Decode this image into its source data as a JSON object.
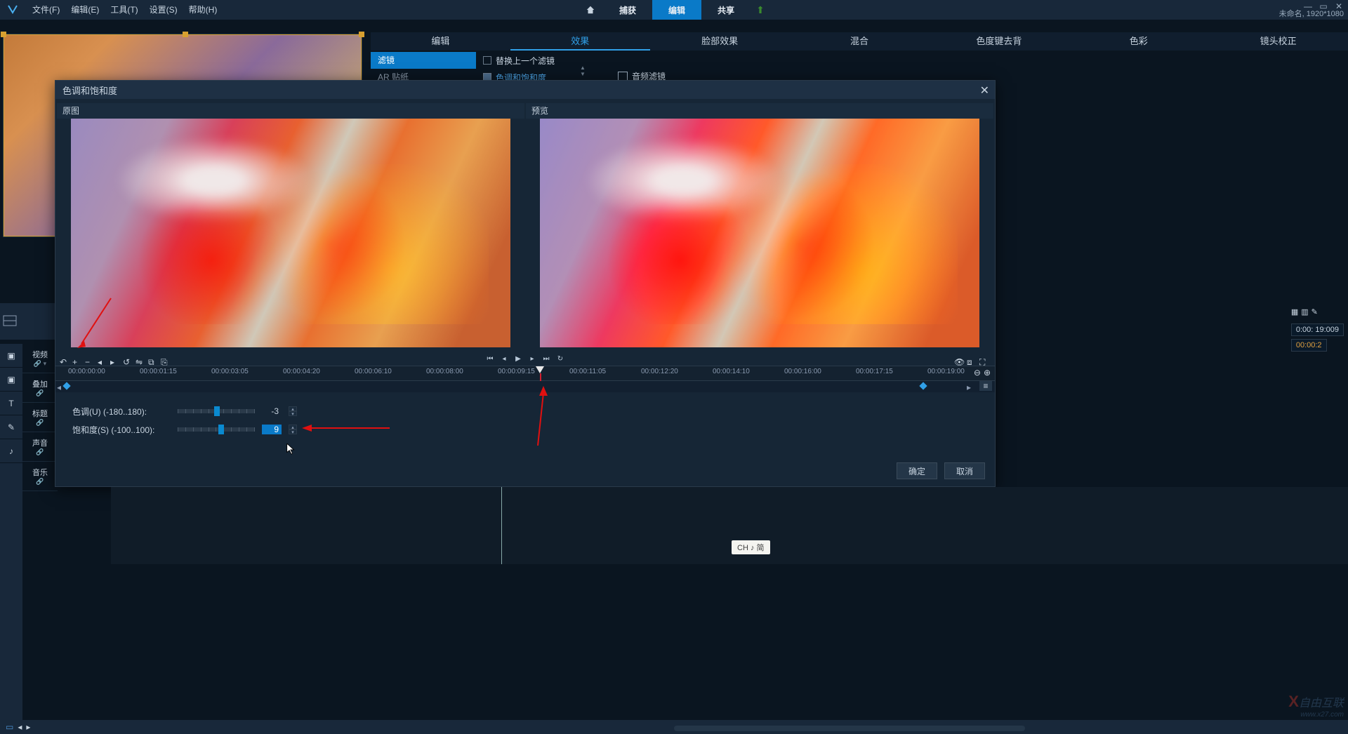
{
  "menu": {
    "file": "文件(F)",
    "edit": "编辑(E)",
    "tools": "工具(T)",
    "settings": "设置(S)",
    "help": "帮助(H)"
  },
  "modes": {
    "capture": "捕获",
    "edit": "编辑",
    "share": "共享"
  },
  "project": {
    "name": "未命名, 1920*1080"
  },
  "tabs": {
    "edit": "编辑",
    "effect": "效果",
    "face": "脸部效果",
    "blend": "混合",
    "chroma": "色度键去背",
    "color": "色彩",
    "lens": "镜头校正"
  },
  "sub": {
    "filter": "滤镜",
    "ar": "AR 贴纸",
    "replace": "替换上一个滤镜",
    "hs": "色调和饱和度",
    "audio": "音频滤镜"
  },
  "tracks": {
    "video": "视频",
    "overlay": "叠加",
    "title": "标题",
    "voice": "声音",
    "music": "音乐"
  },
  "dialog": {
    "title": "色调和饱和度",
    "orig": "原图",
    "prev": "预览",
    "hue_label": "色调(U) (-180..180):",
    "hue_val": "-3",
    "sat_label": "饱和度(S) (-100..100):",
    "sat_val": "9",
    "ok": "确定",
    "cancel": "取消"
  },
  "ruler": [
    "00:00:00:00",
    "00:00:01:15",
    "00:00:03:05",
    "00:00:04:20",
    "00:00:06:10",
    "00:00:08:00",
    "00:00:09:15",
    "00:00:11:05",
    "00:00:12:20",
    "00:00:14:10",
    "00:00:16:00",
    "00:00:17:15",
    "00:00:19:00"
  ],
  "rtime": {
    "dur": "0:00: 19:009",
    "pos": "00:00:2"
  },
  "ime": "CH ♪ 简",
  "wm": "自由互联",
  "wmurl": "www.x27.com"
}
